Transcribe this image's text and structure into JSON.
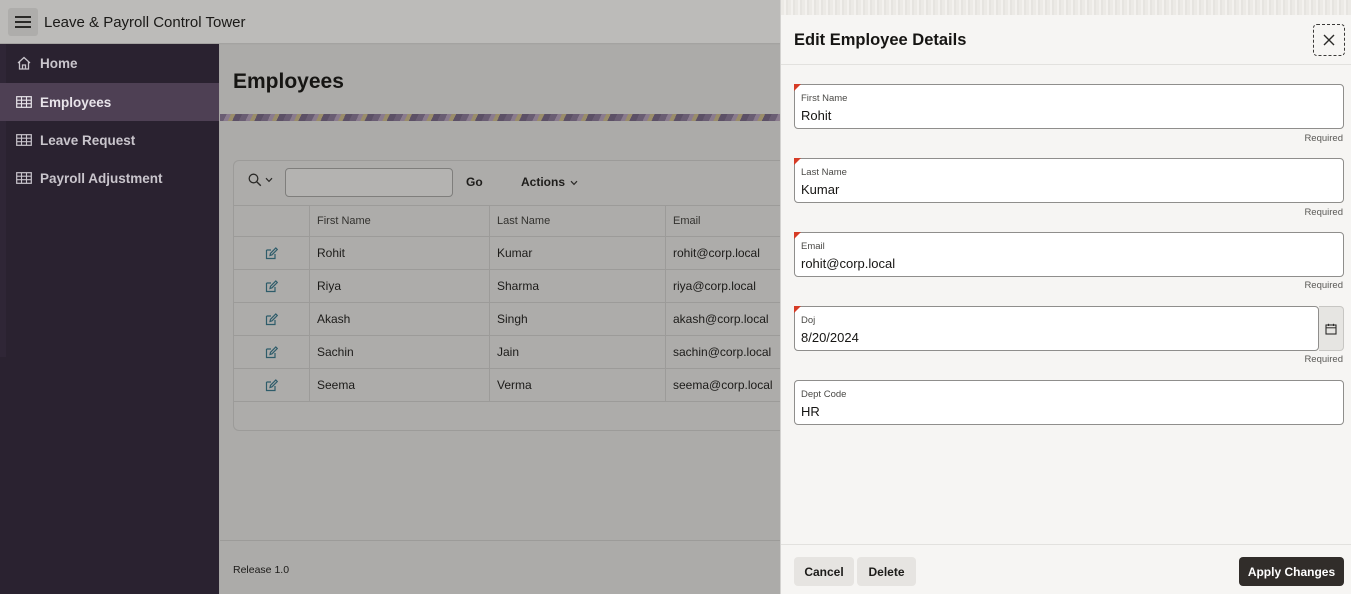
{
  "app": {
    "title": "Leave & Payroll Control Tower"
  },
  "sidebar": {
    "items": [
      {
        "label": "Home",
        "icon": "home-icon",
        "active": false
      },
      {
        "label": "Employees",
        "icon": "table-icon",
        "active": true
      },
      {
        "label": "Leave Request",
        "icon": "table-icon",
        "active": false
      },
      {
        "label": "Payroll Adjustment",
        "icon": "table-icon",
        "active": false
      }
    ]
  },
  "main": {
    "page_title": "Employees",
    "toolbar": {
      "go_label": "Go",
      "actions_label": "Actions",
      "search_value": ""
    },
    "grid": {
      "columns": [
        "First Name",
        "Last Name",
        "Email"
      ],
      "rows": [
        {
          "first": "Rohit",
          "last": "Kumar",
          "email": "rohit@corp.local"
        },
        {
          "first": "Riya",
          "last": "Sharma",
          "email": "riya@corp.local"
        },
        {
          "first": "Akash",
          "last": "Singh",
          "email": "akash@corp.local"
        },
        {
          "first": "Sachin",
          "last": "Jain",
          "email": "sachin@corp.local"
        },
        {
          "first": "Seema",
          "last": "Verma",
          "email": "seema@corp.local"
        }
      ]
    },
    "footer": {
      "release": "Release 1.0"
    }
  },
  "drawer": {
    "title": "Edit Employee Details",
    "fields": {
      "first_name": {
        "label": "First Name",
        "value": "Rohit",
        "required": "Required"
      },
      "last_name": {
        "label": "Last Name",
        "value": "Kumar",
        "required": "Required"
      },
      "email": {
        "label": "Email",
        "value": "rohit@corp.local",
        "required": "Required"
      },
      "doj": {
        "label": "Doj",
        "value": "8/20/2024",
        "required": "Required"
      },
      "dept_code": {
        "label": "Dept Code",
        "value": "HR"
      }
    },
    "buttons": {
      "cancel": "Cancel",
      "delete": "Delete",
      "apply": "Apply Changes"
    }
  },
  "colors": {
    "sidebar_bg": "#2a2230",
    "sidebar_active": "#4e4054",
    "primary_button": "#312d2a",
    "required_marker": "#d63b25"
  }
}
